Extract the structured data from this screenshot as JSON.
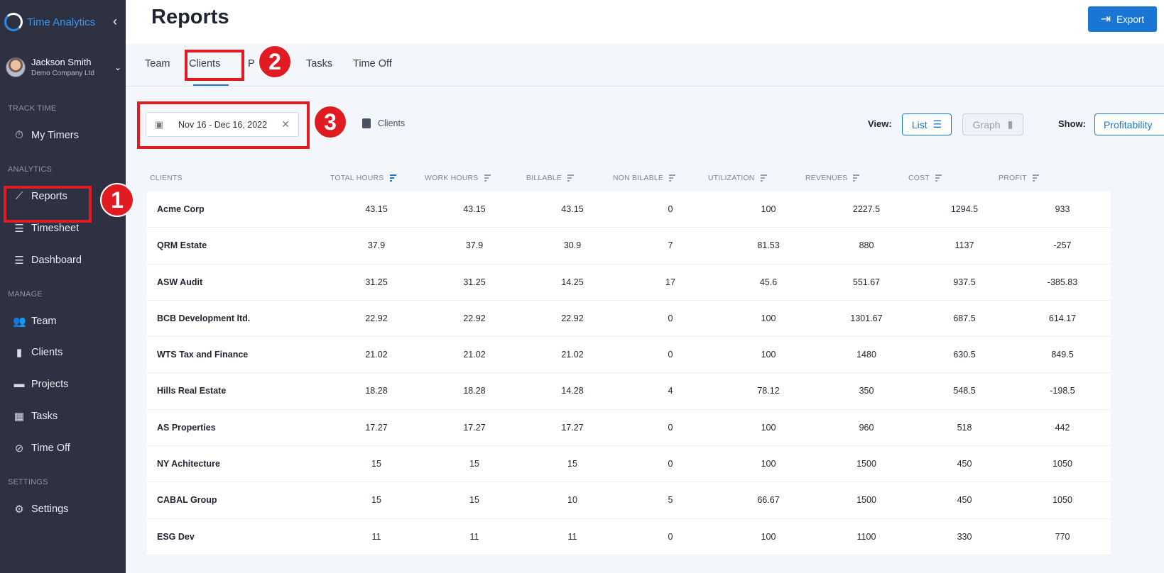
{
  "app": {
    "name": "Time Analytics",
    "collapse_icon": "chevron-left-icon"
  },
  "user": {
    "name": "Jackson Smith",
    "company": "Demo Company Ltd"
  },
  "sidebar": {
    "sections": {
      "track": "TRACK TIME",
      "analytics": "ANALYTICS",
      "manage": "MANAGE",
      "settings": "SETTINGS"
    },
    "items": [
      {
        "label": "My Timers",
        "icon": "stopwatch-icon"
      },
      {
        "label": "Reports",
        "icon": "chart-line-icon"
      },
      {
        "label": "Timesheet",
        "icon": "list-check-icon"
      },
      {
        "label": "Dashboard",
        "icon": "list-check-icon"
      },
      {
        "label": "Team",
        "icon": "people-icon"
      },
      {
        "label": "Clients",
        "icon": "contact-file-icon"
      },
      {
        "label": "Projects",
        "icon": "folder-icon"
      },
      {
        "label": "Tasks",
        "icon": "tasks-icon"
      },
      {
        "label": "Time Off",
        "icon": "timer-off-icon"
      },
      {
        "label": "Settings",
        "icon": "gear-icon"
      }
    ]
  },
  "header": {
    "title": "Reports",
    "export_label": "Export"
  },
  "tabs": [
    {
      "label": "Team"
    },
    {
      "label": "Clients"
    },
    {
      "label": "P"
    },
    {
      "label": "Tasks"
    },
    {
      "label": "Time Off"
    }
  ],
  "filters": {
    "date_range": "Nov 16 - Dec 16, 2022",
    "group_label": "Clients",
    "view_label": "View:",
    "list_label": "List",
    "graph_label": "Graph",
    "show_label": "Show:",
    "show_value": "Profitability"
  },
  "table": {
    "headers": [
      "CLIENTS",
      "TOTAL HOURS",
      "WORK HOURS",
      "BILLABLE",
      "NON BILABLE",
      "UTILIZATION",
      "REVENUES",
      "COST",
      "PROFIT"
    ],
    "rows": [
      [
        "Acme Corp",
        "43.15",
        "43.15",
        "43.15",
        "0",
        "100",
        "2227.5",
        "1294.5",
        "933"
      ],
      [
        "QRM Estate",
        "37.9",
        "37.9",
        "30.9",
        "7",
        "81.53",
        "880",
        "1137",
        "-257"
      ],
      [
        "ASW Audit",
        "31.25",
        "31.25",
        "14.25",
        "17",
        "45.6",
        "551.67",
        "937.5",
        "-385.83"
      ],
      [
        "BCB Development ltd.",
        "22.92",
        "22.92",
        "22.92",
        "0",
        "100",
        "1301.67",
        "687.5",
        "614.17"
      ],
      [
        "WTS Tax and Finance",
        "21.02",
        "21.02",
        "21.02",
        "0",
        "100",
        "1480",
        "630.5",
        "849.5"
      ],
      [
        "Hills Real Estate",
        "18.28",
        "18.28",
        "14.28",
        "4",
        "78.12",
        "350",
        "548.5",
        "-198.5"
      ],
      [
        "AS Properties",
        "17.27",
        "17.27",
        "17.27",
        "0",
        "100",
        "960",
        "518",
        "442"
      ],
      [
        "NY Achitecture",
        "15",
        "15",
        "15",
        "0",
        "100",
        "1500",
        "450",
        "1050"
      ],
      [
        "CABAL Group",
        "15",
        "15",
        "10",
        "5",
        "66.67",
        "1500",
        "450",
        "1050"
      ],
      [
        "ESG Dev",
        "11",
        "11",
        "11",
        "0",
        "100",
        "1100",
        "330",
        "770"
      ]
    ]
  },
  "annotations": [
    "1",
    "2",
    "3"
  ],
  "colors": {
    "accent": "#1976d2",
    "sidebar_bg": "#2d3142",
    "annotation": "#e11b22"
  }
}
